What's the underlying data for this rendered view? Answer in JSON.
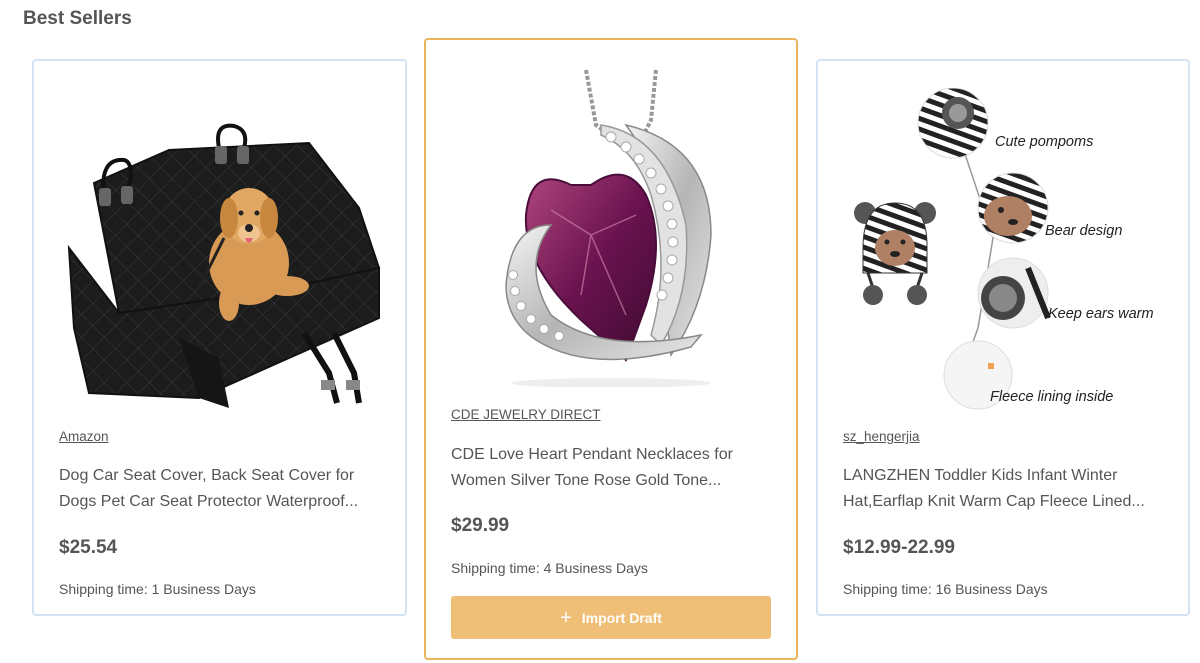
{
  "section": {
    "title": "Best Sellers"
  },
  "products": [
    {
      "vendor": "Amazon",
      "title": "Dog Car Seat Cover, Back Seat Cover for Dogs Pet Car Seat Protector Waterproof...",
      "price": "$25.54",
      "shipping": "Shipping time: 1 Business Days"
    },
    {
      "vendor": "CDE JEWELRY DIRECT",
      "title": "CDE Love Heart Pendant Necklaces for Women Silver Tone Rose Gold Tone...",
      "price": "$29.99",
      "shipping": "Shipping time: 4 Business Days",
      "import_label": "Import Draft",
      "import_icon": "plus-icon"
    },
    {
      "vendor": "sz_hengerjia",
      "title": "LANGZHEN Toddler Kids Infant Winter Hat,Earflap Knit Warm Cap Fleece Lined...",
      "price": "$12.99-22.99",
      "shipping": "Shipping time: 16 Business Days",
      "image_callouts": [
        "Cute pompoms",
        "Bear design",
        "Keep ears warm",
        "Fleece lining inside"
      ]
    }
  ],
  "colors": {
    "card_border": "#d3e3f1",
    "active_border": "#e8b45c",
    "button_bg": "#f0bf77",
    "text": "#555555"
  }
}
